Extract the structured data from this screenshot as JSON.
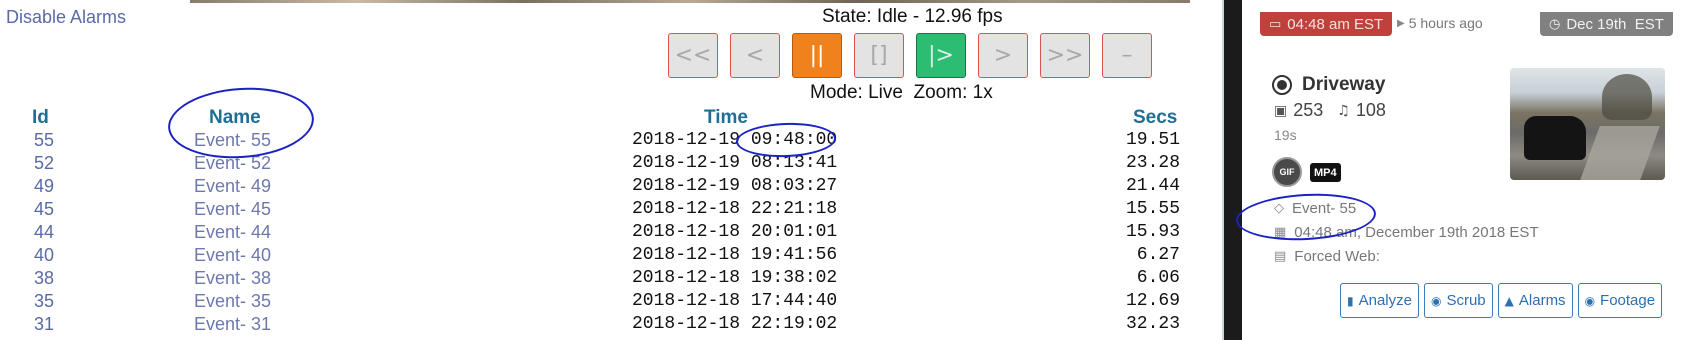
{
  "left": {
    "disable_alarms": "Disable Alarms",
    "state": "State: Idle - 12.96 fps",
    "mode": "Mode: Live  Zoom: 1x",
    "controls": [
      "<<",
      "<",
      "||",
      "[]",
      "|>",
      ">",
      ">>",
      "–"
    ],
    "table": {
      "headers": {
        "id": "Id",
        "name": "Name",
        "time": "Time",
        "secs": "Secs"
      },
      "rows": [
        {
          "id": "55",
          "name": "Event- 55",
          "time": "2018-12-19 09:48:00",
          "secs": "19.51"
        },
        {
          "id": "52",
          "name": "Event- 52",
          "time": "2018-12-19 08:13:41",
          "secs": "23.28"
        },
        {
          "id": "49",
          "name": "Event- 49",
          "time": "2018-12-19 08:03:27",
          "secs": "21.44"
        },
        {
          "id": "45",
          "name": "Event- 45",
          "time": "2018-12-18 22:21:18",
          "secs": "15.55"
        },
        {
          "id": "44",
          "name": "Event- 44",
          "time": "2018-12-18 20:01:01",
          "secs": "15.93"
        },
        {
          "id": "40",
          "name": "Event- 40",
          "time": "2018-12-18 19:41:56",
          "secs": "6.27"
        },
        {
          "id": "38",
          "name": "Event- 38",
          "time": "2018-12-18 19:38:02",
          "secs": "6.06"
        },
        {
          "id": "35",
          "name": "Event- 35",
          "time": "2018-12-18 17:44:40",
          "secs": "12.69"
        },
        {
          "id": "31",
          "name": "Event- 31",
          "time": "2018-12-18 22:19:02",
          "secs": "32.23"
        }
      ]
    }
  },
  "card": {
    "date_badge": "04:48 am EST",
    "ago": "5 hours ago",
    "clock_badge": "Dec 19th  EST",
    "monitor_name": "Driveway",
    "images_count": "253",
    "alarms_count": "108",
    "duration": "19s",
    "gif_label": "GIF",
    "mp4_label": "MP4",
    "event_name": "Event- 55",
    "event_datetime": "04:48 am, December 19th 2018 EST",
    "forced_web": "Forced Web:",
    "actions": [
      "Analyze",
      "Scrub",
      "Alarms",
      "Footage"
    ]
  },
  "colors": {
    "accent_red": "#c0413b",
    "pause_orange": "#f0821e",
    "play_green": "#2cbd73",
    "header_blue": "#1f6f94",
    "annotation_blue": "#1a22c4"
  }
}
